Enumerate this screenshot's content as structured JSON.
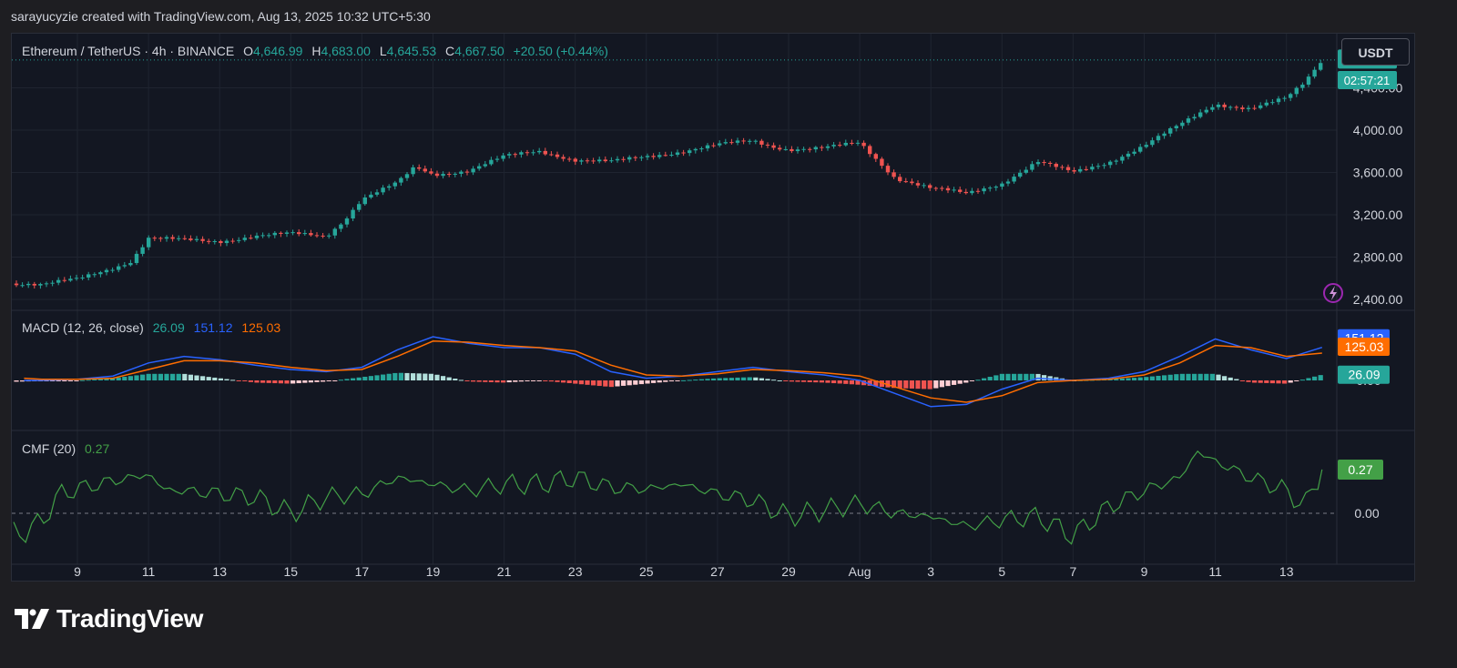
{
  "caption": "sarayucyzie created with TradingView.com, Aug 13, 2025 10:32 UTC+5:30",
  "symbol_legend": {
    "title": "Ethereum / TetherUS · 4h · BINANCE",
    "open_label": "O",
    "open": "4,646.99",
    "high_label": "H",
    "high": "4,683.00",
    "low_label": "L",
    "low": "4,645.53",
    "close_label": "C",
    "close": "4,667.50",
    "change": "+20.50 (+0.44%)"
  },
  "currency_button": "USDT",
  "price_tag": "02:57:21",
  "macd_legend": {
    "label": "MACD (12, 26, close)",
    "hist": "26.09",
    "macd": "151.12",
    "signal": "125.03"
  },
  "cmf_legend": {
    "label": "CMF (20)",
    "value": "0.27"
  },
  "brand": "TradingView",
  "colors": {
    "up": "#26a69a",
    "down": "#ef5350",
    "macd": "#2962ff",
    "signal": "#ff6d00",
    "cmf": "#43a047",
    "background": "#131722"
  },
  "chart_data": [
    {
      "type": "line",
      "title": "Ethereum / TetherUS · 4h · BINANCE",
      "series": [
        {
          "name": "Close",
          "x": [
            "Jul 7.5",
            "Jul 8",
            "Jul 9",
            "Jul 10",
            "Jul 10.5",
            "Jul 11",
            "Jul 12",
            "Jul 13",
            "Jul 14",
            "Jul 15",
            "Jul 16",
            "Jul 16.5",
            "Jul 17",
            "Jul 18",
            "Jul 18.5",
            "Jul 19",
            "Jul 20",
            "Jul 21",
            "Jul 22",
            "Jul 23",
            "Jul 24",
            "Jul 25",
            "Jul 26",
            "Jul 27",
            "Jul 28",
            "Jul 28.5",
            "Jul 29",
            "Jul 30",
            "Jul 31",
            "Aug 1",
            "Aug 2",
            "Aug 3",
            "Aug 4",
            "Aug 5",
            "Aug 6",
            "Aug 7",
            "Aug 8",
            "Aug 9",
            "Aug 10",
            "Aug 11",
            "Aug 12",
            "Aug 12.5",
            "Aug 13"
          ],
          "values": [
            2550,
            2540,
            2590,
            2700,
            2760,
            2980,
            2960,
            2950,
            3000,
            3020,
            3000,
            3150,
            3350,
            3500,
            3650,
            3580,
            3620,
            3750,
            3800,
            3720,
            3700,
            3750,
            3800,
            3860,
            3900,
            3850,
            3820,
            3830,
            3880,
            3550,
            3450,
            3400,
            3500,
            3700,
            3600,
            3700,
            3850,
            4050,
            4250,
            4200,
            4300,
            4450,
            4667.5
          ]
        }
      ],
      "ylabel": "",
      "ylim": [
        2400,
        4700
      ],
      "y_ticks": [
        "2,400.00",
        "2,800.00",
        "3,200.00",
        "3,600.00",
        "4,000.00",
        "4,400.00"
      ],
      "x_ticks": [
        "9",
        "11",
        "13",
        "15",
        "17",
        "19",
        "21",
        "23",
        "25",
        "27",
        "29",
        "Aug",
        "3",
        "5",
        "7",
        "9",
        "11",
        "13"
      ],
      "last_price": "4,667.50"
    },
    {
      "type": "line",
      "title": "MACD (12, 26, close)",
      "series": [
        {
          "name": "MACD",
          "x": [
            "Jul 7.5",
            "Jul 8",
            "Jul 9",
            "Jul 10",
            "Jul 11",
            "Jul 12",
            "Jul 13",
            "Jul 14",
            "Jul 15",
            "Jul 16",
            "Jul 17",
            "Jul 18",
            "Jul 19",
            "Jul 20",
            "Jul 21",
            "Jul 22",
            "Jul 23",
            "Jul 24",
            "Jul 25",
            "Jul 26",
            "Jul 27",
            "Jul 28",
            "Jul 29",
            "Jul 30",
            "Jul 31",
            "Aug 1",
            "Aug 2",
            "Aug 3",
            "Aug 4",
            "Aug 5",
            "Aug 6",
            "Aug 7",
            "Aug 8",
            "Aug 9",
            "Aug 10",
            "Aug 11",
            "Aug 12",
            "Aug 13"
          ],
          "values": [
            0,
            0,
            5,
            20,
            80,
            110,
            95,
            70,
            50,
            40,
            60,
            140,
            200,
            170,
            150,
            150,
            120,
            40,
            10,
            20,
            40,
            60,
            40,
            25,
            0,
            -60,
            -120,
            -110,
            -40,
            10,
            0,
            10,
            40,
            110,
            190,
            140,
            100,
            151.12
          ]
        },
        {
          "name": "Signal",
          "x": [
            "Jul 7.5",
            "Jul 8",
            "Jul 9",
            "Jul 10",
            "Jul 11",
            "Jul 12",
            "Jul 13",
            "Jul 14",
            "Jul 15",
            "Jul 16",
            "Jul 17",
            "Jul 18",
            "Jul 19",
            "Jul 20",
            "Jul 21",
            "Jul 22",
            "Jul 23",
            "Jul 24",
            "Jul 25",
            "Jul 26",
            "Jul 27",
            "Jul 28",
            "Jul 29",
            "Jul 30",
            "Jul 31",
            "Aug 1",
            "Aug 2",
            "Aug 3",
            "Aug 4",
            "Aug 5",
            "Aug 6",
            "Aug 7",
            "Aug 8",
            "Aug 9",
            "Aug 10",
            "Aug 11",
            "Aug 12",
            "Aug 13"
          ],
          "values": [
            10,
            5,
            5,
            10,
            50,
            90,
            90,
            80,
            60,
            45,
            50,
            110,
            180,
            175,
            160,
            150,
            135,
            70,
            25,
            20,
            30,
            50,
            45,
            35,
            20,
            -30,
            -80,
            -100,
            -70,
            -10,
            0,
            5,
            25,
            80,
            160,
            150,
            110,
            125.03
          ]
        },
        {
          "name": "Histogram",
          "x": [
            "Jul 7.5",
            "Jul 8",
            "Jul 9",
            "Jul 10",
            "Jul 11",
            "Jul 12",
            "Jul 13",
            "Jul 14",
            "Jul 15",
            "Jul 16",
            "Jul 17",
            "Jul 18",
            "Jul 19",
            "Jul 20",
            "Jul 21",
            "Jul 22",
            "Jul 23",
            "Jul 24",
            "Jul 25",
            "Jul 26",
            "Jul 27",
            "Jul 28",
            "Jul 29",
            "Jul 30",
            "Jul 31",
            "Aug 1",
            "Aug 2",
            "Aug 3",
            "Aug 4",
            "Aug 5",
            "Aug 6",
            "Aug 7",
            "Aug 8",
            "Aug 9",
            "Aug 10",
            "Aug 11",
            "Aug 12",
            "Aug 13"
          ],
          "values": [
            -5,
            -3,
            0,
            10,
            30,
            30,
            10,
            -10,
            -15,
            -5,
            15,
            35,
            30,
            -5,
            -10,
            0,
            -15,
            -30,
            -15,
            0,
            10,
            15,
            -5,
            -10,
            -20,
            -35,
            -40,
            -10,
            30,
            30,
            0,
            5,
            15,
            30,
            30,
            -10,
            -15,
            26.09
          ]
        }
      ],
      "y_ticks": [
        "0.00"
      ]
    },
    {
      "type": "line",
      "title": "CMF (20)",
      "series": [
        {
          "name": "CMF",
          "x": [
            "Jul 7.5",
            "Jul 8",
            "Jul 8.5",
            "Jul 9",
            "Jul 10",
            "Jul 11",
            "Jul 11.5",
            "Jul 12",
            "Jul 13",
            "Jul 14",
            "Jul 15",
            "Jul 16",
            "Jul 17",
            "Jul 18",
            "Jul 19",
            "Jul 20",
            "Jul 21",
            "Jul 22",
            "Jul 23",
            "Jul 24",
            "Jul 25",
            "Jul 26",
            "Jul 27",
            "Jul 28",
            "Jul 29",
            "Jul 30",
            "Jul 31",
            "Aug 1",
            "Aug 2",
            "Aug 3",
            "Aug 4",
            "Aug 5",
            "Aug 6",
            "Aug 7",
            "Aug 8",
            "Aug 9",
            "Aug 9.5",
            "Aug 10",
            "Aug 11",
            "Aug 12",
            "Aug 12.5",
            "Aug 13"
          ],
          "values": [
            -0.12,
            -0.05,
            0.12,
            0.15,
            0.2,
            0.24,
            0.14,
            0.14,
            0.12,
            0.1,
            0.0,
            0.1,
            0.12,
            0.22,
            0.18,
            0.14,
            0.18,
            0.18,
            0.22,
            0.16,
            0.15,
            0.18,
            0.12,
            0.08,
            -0.02,
            0.02,
            0.06,
            0.0,
            -0.02,
            -0.08,
            -0.04,
            -0.02,
            -0.14,
            0.04,
            0.14,
            0.22,
            0.38,
            0.32,
            0.22,
            0.14,
            0.04,
            0.27
          ]
        }
      ],
      "y_ticks": [
        "0.00"
      ]
    }
  ]
}
